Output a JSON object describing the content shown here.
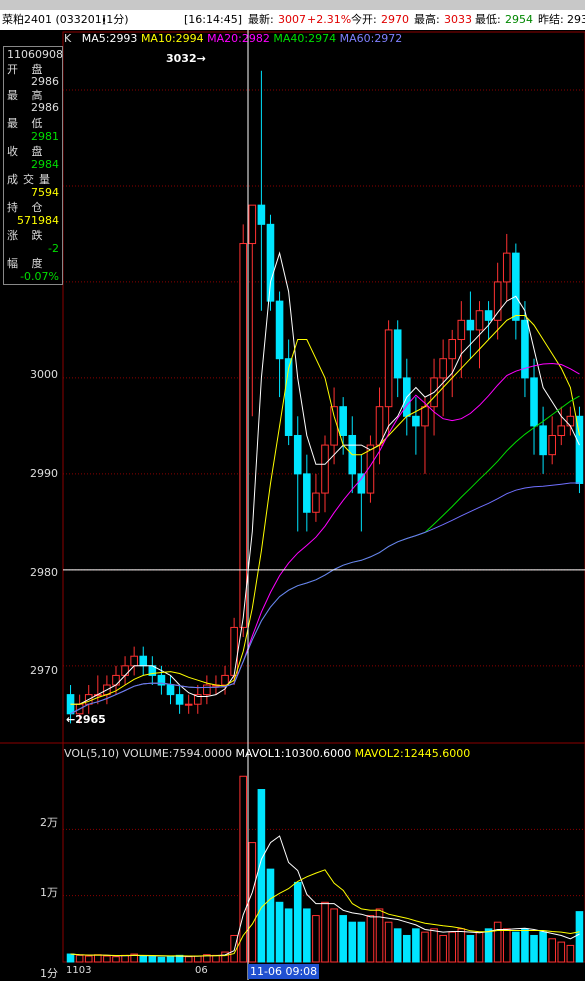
{
  "header": {
    "instrument": "菜粕2401 (033201)",
    "period": "(1分)",
    "time": "[16:14:45]",
    "latest_label": "最新:",
    "latest_value": "3007",
    "change": "+2.31%",
    "open_label": "今开:",
    "open_value": "2970",
    "high_label": "最高:",
    "high_value": "3033",
    "low_label": "最低:",
    "low_value": "2954",
    "prev_close_label": "昨结:",
    "prev_close_value": "293"
  },
  "ma_legend": {
    "k": "K",
    "ma5": "MA5:2993",
    "ma10": "MA10:2994",
    "ma20": "MA20:2982",
    "ma40": "MA40:2974",
    "ma60": "MA60:2972"
  },
  "info_box": {
    "datetime": "11060908",
    "open_label": "开 盘",
    "open_value": "2986",
    "high_label": "最 高",
    "high_value": "2986",
    "low_label": "最 低",
    "low_value": "2981",
    "close_label": "收 盘",
    "close_value": "2984",
    "volume_label": "成交量",
    "volume_value": "7594",
    "oi_label": "持 仓",
    "oi_value": "571984",
    "change_label": "涨 跌",
    "change_value": "-2",
    "pct_label": "幅 度",
    "pct_value": "-0.07%"
  },
  "price_axis": [
    "3000",
    "2990",
    "2980",
    "2970"
  ],
  "annotations": {
    "high_mark": "3032",
    "low_mark": "2965"
  },
  "volume_legend": {
    "title": "VOL(5,10)",
    "volume": "VOLUME:7594.0000",
    "mavol1": "MAVOL1:10300.6000",
    "mavol2": "MAVOL2:12445.6000"
  },
  "volume_axis": [
    "2万",
    "1万"
  ],
  "time_axis": {
    "period": "1分",
    "t1": "1103",
    "t2": "06",
    "cursor": "11-06 09:08"
  },
  "colors": {
    "up": "#ff3232",
    "down": "#00e5ff",
    "ma5": "#ffffff",
    "ma10": "#ffff00",
    "ma20": "#ff00ff",
    "ma40": "#00e000",
    "ma60": "#7070ff",
    "grid": "#8b0000"
  },
  "chart_data": {
    "type": "candlestick",
    "price_range": [
      2963,
      3035
    ],
    "candles": [
      [
        2967,
        2968,
        2964,
        2965
      ],
      [
        2965,
        2967,
        2964,
        2966
      ],
      [
        2966,
        2968,
        2965,
        2967
      ],
      [
        2967,
        2969,
        2966,
        2967
      ],
      [
        2967,
        2969,
        2966,
        2968
      ],
      [
        2968,
        2970,
        2967,
        2969
      ],
      [
        2969,
        2971,
        2968,
        2970
      ],
      [
        2970,
        2972,
        2969,
        2971
      ],
      [
        2971,
        2972,
        2969,
        2970
      ],
      [
        2970,
        2971,
        2968,
        2969
      ],
      [
        2969,
        2970,
        2967,
        2968
      ],
      [
        2968,
        2969,
        2966,
        2967
      ],
      [
        2967,
        2968,
        2965,
        2966
      ],
      [
        2966,
        2967,
        2965,
        2966
      ],
      [
        2966,
        2968,
        2965,
        2967
      ],
      [
        2967,
        2969,
        2966,
        2968
      ],
      [
        2968,
        2969,
        2967,
        2968
      ],
      [
        2968,
        2970,
        2967,
        2969
      ],
      [
        2969,
        2975,
        2968,
        2974
      ],
      [
        2974,
        3016,
        2973,
        3014
      ],
      [
        3014,
        3018,
        2996,
        3018
      ],
      [
        3018,
        3032,
        3007,
        3016
      ],
      [
        3016,
        3017,
        3007,
        3008
      ],
      [
        3008,
        3009,
        2998,
        3002
      ],
      [
        3002,
        3004,
        2993,
        2994
      ],
      [
        2994,
        2996,
        2984,
        2990
      ],
      [
        2990,
        2992,
        2984,
        2986
      ],
      [
        2986,
        2990,
        2985,
        2988
      ],
      [
        2988,
        2994,
        2986,
        2993
      ],
      [
        2993,
        2999,
        2991,
        2997
      ],
      [
        2997,
        2998,
        2992,
        2994
      ],
      [
        2994,
        2996,
        2988,
        2990
      ],
      [
        2990,
        2992,
        2984,
        2988
      ],
      [
        2988,
        2994,
        2987,
        2993
      ],
      [
        2993,
        2999,
        2991,
        2997
      ],
      [
        2997,
        3006,
        2994,
        3005
      ],
      [
        3005,
        3006,
        2998,
        3000
      ],
      [
        3000,
        3002,
        2994,
        2996
      ],
      [
        2996,
        2998,
        2992,
        2995
      ],
      [
        2995,
        2998,
        2990,
        2997
      ],
      [
        2997,
        3002,
        2994,
        3000
      ],
      [
        3000,
        3004,
        2996,
        3002
      ],
      [
        3002,
        3005,
        2998,
        3004
      ],
      [
        3004,
        3008,
        3000,
        3006
      ],
      [
        3006,
        3009,
        3002,
        3005
      ],
      [
        3005,
        3008,
        3001,
        3007
      ],
      [
        3007,
        3008,
        3004,
        3006
      ],
      [
        3006,
        3012,
        3004,
        3010
      ],
      [
        3010,
        3015,
        3008,
        3013
      ],
      [
        3013,
        3014,
        3004,
        3006
      ],
      [
        3006,
        3008,
        2998,
        3000
      ],
      [
        3000,
        3002,
        2992,
        2995
      ],
      [
        2995,
        2997,
        2990,
        2992
      ],
      [
        2992,
        2996,
        2991,
        2994
      ],
      [
        2994,
        2997,
        2993,
        2995
      ],
      [
        2995,
        2997,
        2994,
        2996
      ],
      [
        2996,
        2997,
        2988,
        2989
      ]
    ],
    "volumes": [
      1200,
      1000,
      900,
      1100,
      900,
      800,
      1000,
      1200,
      900,
      800,
      700,
      900,
      1000,
      800,
      900,
      1100,
      1000,
      1500,
      4000,
      28000,
      18000,
      26000,
      14000,
      9000,
      8000,
      12000,
      8000,
      7000,
      9000,
      8000,
      7000,
      6000,
      6000,
      7000,
      8000,
      6000,
      5000,
      4000,
      5000,
      4500,
      5000,
      4000,
      4500,
      5000,
      4000,
      4500,
      5000,
      6000,
      5000,
      4500,
      5000,
      4000,
      4500,
      3500,
      3000,
      2500,
      7594
    ],
    "ma5": [
      2966,
      2966,
      2966.5,
      2967,
      2967.5,
      2968,
      2969,
      2970,
      2970,
      2970,
      2969.5,
      2969,
      2968,
      2967.2,
      2966.8,
      2966.8,
      2967,
      2967.6,
      2969,
      2975,
      2984,
      3000,
      3010,
      3013,
      3009,
      3000,
      2994,
      2991,
      2991,
      2992,
      2993,
      2993,
      2993,
      2992.5,
      2993,
      2995,
      2996,
      2998,
      2999,
      2998,
      2998.5,
      2999.5,
      3000.5,
      3002.5,
      3003.5,
      3004.5,
      3005.5,
      3006.8,
      3008,
      3008.5,
      3007,
      3003,
      2999,
      2997.5,
      2996,
      2995,
      2993
    ],
    "ma10": [
      2966,
      2966,
      2966.3,
      2966.7,
      2967,
      2967.4,
      2968,
      2968.6,
      2969,
      2969.2,
      2969.3,
      2969.4,
      2969.2,
      2968.8,
      2968.5,
      2968.2,
      2968,
      2967.9,
      2968.5,
      2971.5,
      2976,
      2982,
      2989,
      2995,
      3001,
      3004,
      3004,
      3002,
      3000,
      2996,
      2993,
      2992,
      2992,
      2992.5,
      2993,
      2994,
      2995,
      2996,
      2996.5,
      2997,
      2998,
      2999,
      3000,
      3001,
      3002,
      3003,
      3004,
      3005,
      3006,
      3006.5,
      3006.5,
      3005.5,
      3004,
      3002.5,
      3001,
      2999,
      2994
    ]
  }
}
